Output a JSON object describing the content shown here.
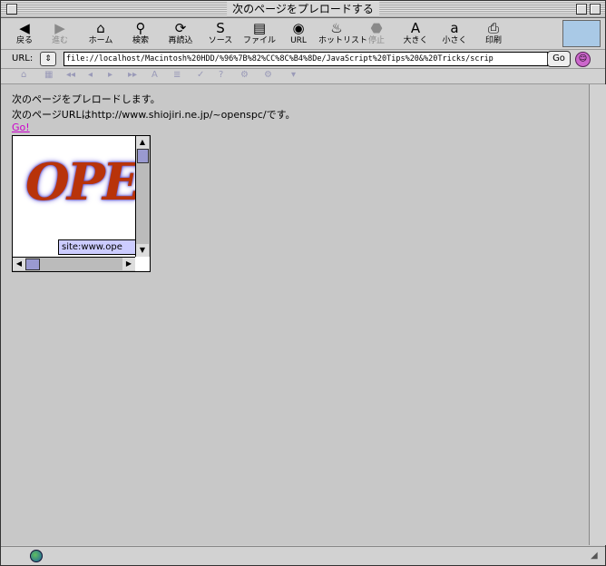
{
  "window": {
    "title": "次のページをプレロードする"
  },
  "toolbar": {
    "buttons": [
      {
        "label": "戻る",
        "icon": "back-arrow-icon",
        "glyph": "◀",
        "enabled": true
      },
      {
        "label": "進む",
        "icon": "forward-arrow-icon",
        "glyph": "▶",
        "enabled": false
      },
      {
        "label": "ホーム",
        "icon": "home-icon",
        "glyph": "⌂",
        "enabled": true
      },
      {
        "label": "検索",
        "icon": "search-icon",
        "glyph": "⚲",
        "enabled": true
      },
      {
        "label": "再読込",
        "icon": "reload-icon",
        "glyph": "⟳",
        "enabled": true
      },
      {
        "label": "ソース",
        "icon": "source-icon",
        "glyph": "S",
        "enabled": true
      },
      {
        "label": "ファイル",
        "icon": "file-icon",
        "glyph": "▤",
        "enabled": true
      },
      {
        "label": "URL",
        "icon": "url-icon",
        "glyph": "◉",
        "enabled": true
      },
      {
        "label": "ホットリスト",
        "icon": "hotlist-icon",
        "glyph": "♨",
        "enabled": true
      },
      {
        "label": "停止",
        "icon": "stop-icon",
        "glyph": "⬣",
        "enabled": false
      },
      {
        "label": "大きく",
        "icon": "font-larger-icon",
        "glyph": "A",
        "enabled": true
      },
      {
        "label": "小さく",
        "icon": "font-smaller-icon",
        "glyph": "a",
        "enabled": true
      },
      {
        "label": "印刷",
        "icon": "print-icon",
        "glyph": "⎙",
        "enabled": true
      }
    ]
  },
  "urlbar": {
    "label": "URL:",
    "value": "file://localhost/Macintosh%20HDD/%96%7B%82%CC%8C%B4%8De/JavaScript%20Tips%20&%20Tricks/scrip",
    "go_label": "Go"
  },
  "content": {
    "line1": "次のページをプレロードします。",
    "line2": "次のページURLはhttp://www.shiojiri.ne.jp/~openspc/です。",
    "link": "Go!",
    "logo_text": "OPE",
    "site_label": "site:www.ope"
  }
}
